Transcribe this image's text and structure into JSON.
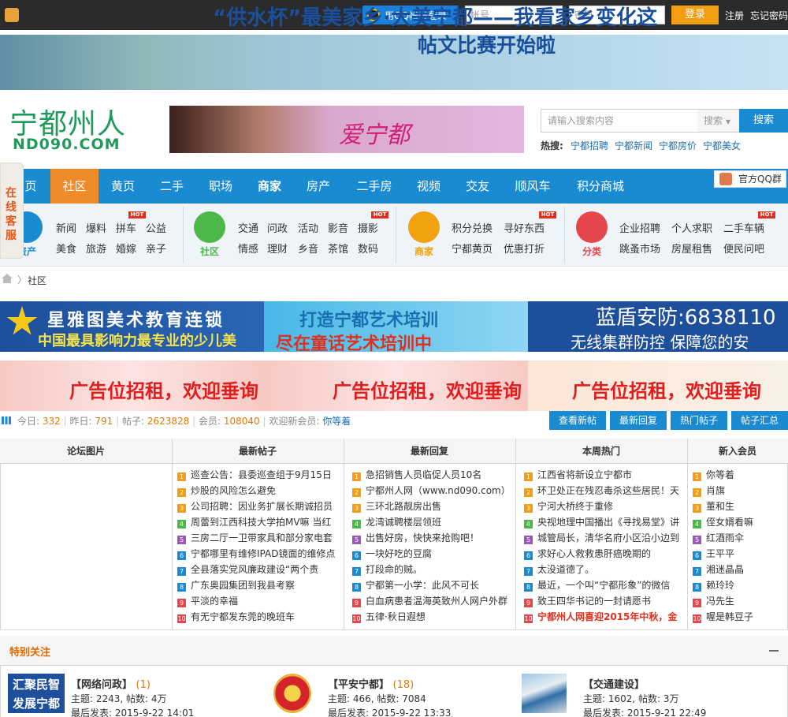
{
  "topbar": {
    "qq_login": "用QQ帐号登录",
    "account_placeholder": "帐号",
    "password_placeholder": "密码",
    "login": "登录",
    "register": "注册",
    "forgot": "忘记密码"
  },
  "banner": {
    "title": "“供水杯”最美家乡·大美宁都——我看家乡变化这",
    "subtitle": "帖文比赛开始啦"
  },
  "site": {
    "name_cn": "宁都州人",
    "name_en": "ND090.COM"
  },
  "header_ad": {
    "text": "爱宁都"
  },
  "search": {
    "placeholder": "请输入搜索内容",
    "select": "搜索",
    "button": "搜索",
    "hot_label": "热搜:",
    "hot_links": [
      "宁都招聘",
      "宁都新闻",
      "宁都房价",
      "宁都美女"
    ]
  },
  "nav": {
    "items": [
      "页",
      "社区",
      "黄页",
      "二手",
      "职场",
      "商家",
      "房产",
      "二手房",
      "视频",
      "交友",
      "顺风车",
      "积分商城"
    ],
    "qq_group": "官方QQ群"
  },
  "side_service": "在线客服",
  "subnav": {
    "cat1_label": "资产",
    "cat1_links": [
      "新闻",
      "爆料",
      "拼车",
      "公益",
      "美食",
      "旅游",
      "婚嫁",
      "亲子"
    ],
    "cat2_label": "社区",
    "cat2_links": [
      "交通",
      "问政",
      "活动",
      "影音",
      "摄影",
      "情感",
      "理财",
      "乡音",
      "茶馆",
      "数码"
    ],
    "cat3_label": "商家",
    "cat3_links": [
      "积分兑换",
      "寻好东西",
      "宁都黄页",
      "优惠打折"
    ],
    "cat4_label": "分类",
    "cat4_links": [
      "企业招聘",
      "个人求职",
      "二手车辆",
      "跳蚤市场",
      "房屋租售",
      "便民问吧"
    ],
    "hot": "HOT"
  },
  "breadcrumb": {
    "sep": "〉",
    "current": "社区"
  },
  "ads": {
    "ad1_top": "星雅图美术教育连锁",
    "ad1_bottom": "中国最具影响力最专业的少儿美",
    "ad2_top": "打造宁都艺术培训",
    "ad2_bottom": "尽在童话艺术培训中",
    "ad3_top": "蓝盾安防:6838110",
    "ad3_bottom": "无线集群防控  保障您的安",
    "rent": "广告位招租，欢迎垂询"
  },
  "stats": {
    "today_label": "今日: ",
    "today": "332",
    "yesterday_label": "昨日: ",
    "yesterday": "791",
    "posts_label": "帖子: ",
    "posts": "2623828",
    "members_label": "会员: ",
    "members": "108040",
    "welcome_label": "欢迎新会员: ",
    "new_member": "你等着",
    "buttons": [
      "查看新帖",
      "最新回复",
      "热门帖子",
      "帖子汇总"
    ]
  },
  "table": {
    "headers": [
      "论坛图片",
      "最新帖子",
      "最新回复",
      "本周热门",
      "新入会员"
    ],
    "latest_posts": [
      "巡查公告：县委巡查组于9月15日",
      "炒股的风险怎么避免",
      "公司招聘：因业务扩展长期诚招员",
      "周蕾到江西科技大学拍MV嘛 当红",
      "三房二厅一卫带家具和部分家电套",
      "宁都哪里有维修IPAD镜面的维修点",
      "全县落实党风廉政建设“两个责",
      "广东奥园集团到我县考察",
      "平淡的幸福",
      "有无宁都发东莞的晚班车"
    ],
    "latest_replies": [
      "急招销售人员临促人员10名",
      "宁都州人网（www.nd090.com）",
      "三环北路靓房出售",
      "龙湾诚聘楼层领班",
      "出售好房，快快来抢购吧！",
      "一块好吃的豆腐",
      "打段命的贼。",
      "宁都第一小学：此风不可长",
      "白血病患者温海英致州人网户外群",
      "五律·秋日遐想"
    ],
    "weekly_hot": [
      "江西省将新设立宁都市",
      "环卫处正在残忍毒杀这些居民！天",
      "宁河大桥终于重修",
      "央视地理中国播出《寻找易堂》讲",
      "城管局长，清华名府小区沿小边到",
      "求好心人救救患肝癌晚期的",
      "太没道德了。",
      "最近，一个叫“宁都形象”的微信",
      "致王四华书记的一封请愿书",
      "宁都州人网喜迎2015年中秋，金"
    ],
    "new_members": [
      "你等着",
      "肖旗",
      "董和生",
      "侄女婿看嘛",
      "红酒雨伞",
      "王平平",
      "湘迷晶晶",
      "赖玲玲",
      "冯先生",
      "喔是韩豆子"
    ],
    "index_labels": [
      "1",
      "2",
      "3",
      "4",
      "5",
      "6",
      "7",
      "8",
      "9",
      "10"
    ]
  },
  "special": {
    "title": "特别关注",
    "items": [
      {
        "name": "【网络问政】",
        "count": "(1)",
        "stats": "主题: 2243, 帖数: 4万",
        "last": "最后发表: 2015-9-22 14:01",
        "logo_text": "汇聚民智发展宁都"
      },
      {
        "name": "【平安宁都】",
        "count": "(18)",
        "stats": "主题: 466, 帖数: 7084",
        "last": "最后发表: 2015-9-22 13:33"
      },
      {
        "name": "【交通建设】",
        "count": "",
        "stats": "主题: 1602, 帖数: 3万",
        "last": "最后发表: 2015-9-21 22:49"
      }
    ]
  }
}
